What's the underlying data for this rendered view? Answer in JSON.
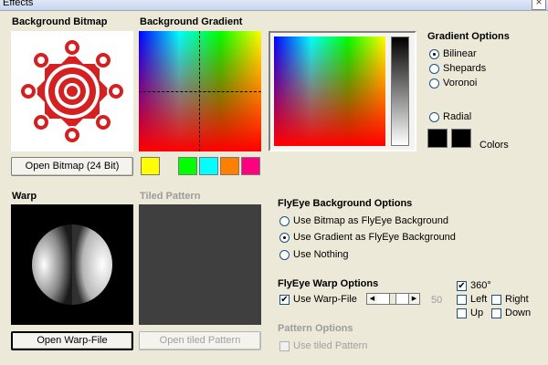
{
  "window": {
    "title": "Effects",
    "close_glyph": "×"
  },
  "background_bitmap": {
    "heading": "Background Bitmap",
    "open_button": "Open Bitmap (24 Bit)"
  },
  "background_gradient": {
    "heading": "Background Gradient",
    "swatches": [
      "#ffff00",
      "#00ff00",
      "#00ffff",
      "#ff8000",
      "#ff0080"
    ]
  },
  "gradient_options": {
    "heading": "Gradient Options",
    "modes": [
      {
        "label": "Bilinear",
        "selected": true
      },
      {
        "label": "Shepards",
        "selected": false
      },
      {
        "label": "Voronoi",
        "selected": false
      },
      {
        "label": "Radial",
        "selected": false
      }
    ],
    "colors_label": "Colors",
    "color_boxes": [
      "#000000",
      "#000000"
    ]
  },
  "warp": {
    "heading": "Warp",
    "open_button": "Open Warp-File"
  },
  "tiled_pattern": {
    "heading": "Tiled Pattern",
    "open_button": "Open tiled Pattern"
  },
  "flyeye_background": {
    "heading": "FlyEye Background Options",
    "options": [
      {
        "label": "Use Bitmap as FlyEye Background",
        "selected": false
      },
      {
        "label": "Use Gradient as FlyEye Background",
        "selected": true
      },
      {
        "label": "Use Nothing",
        "selected": false
      }
    ]
  },
  "flyeye_warp": {
    "heading": "FlyEye Warp Options",
    "use_warp_label": "Use Warp-File",
    "use_warp_checked": true,
    "slider_value": "50",
    "slider_fraction": 0.5,
    "checks": [
      {
        "label": "360°",
        "checked": true
      },
      {
        "label": "Left",
        "checked": false
      },
      {
        "label": "Right",
        "checked": false
      },
      {
        "label": "Up",
        "checked": false
      },
      {
        "label": "Down",
        "checked": false
      }
    ]
  },
  "pattern_options": {
    "heading": "Pattern Options",
    "use_tiled_label": "Use tiled Pattern"
  }
}
